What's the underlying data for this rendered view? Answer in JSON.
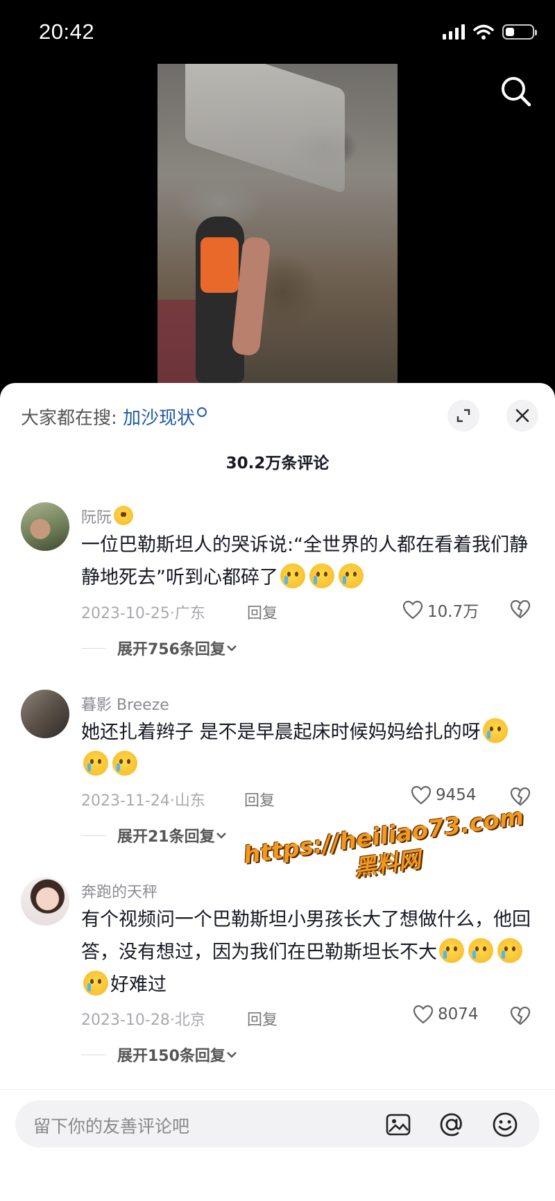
{
  "status_bar": {
    "time": "20:42"
  },
  "sheet": {
    "search_hint_label": "大家都在搜:",
    "search_hint_keyword": "加沙现状",
    "comment_count": "30.2万条评论"
  },
  "comments": [
    {
      "username": "阮阮",
      "text_before": "一位巴勒斯坦人的哭诉说:“全世界的人都在看着我们静静地死去”听到心都碎了",
      "date_location": "2023-10-25·广东",
      "reply_label": "回复",
      "likes": "10.7万",
      "expand_label": "展开756条回复"
    },
    {
      "username": "暮影 Breeze",
      "text_before": "她还扎着辫子 是不是早晨起床时候妈妈给扎的呀",
      "date_location": "2023-11-24·山东",
      "reply_label": "回复",
      "likes": "9454",
      "expand_label": "展开21条回复"
    },
    {
      "username": "奔跑的天秤",
      "text_before": "有个视频问一个巴勒斯坦小男孩长大了想做什么，他回答，没有想过，因为我们在巴勒斯坦长不大",
      "text_after": "好难过",
      "date_location": "2023-10-28·北京",
      "reply_label": "回复",
      "likes": "8074",
      "expand_label": "展开150条回复"
    }
  ],
  "watermark": {
    "url": "https://heiliao73.com",
    "name": "黑料网"
  },
  "input_bar": {
    "placeholder": "留下你的友善评论吧"
  },
  "icons": [
    "search-icon",
    "expand-icon",
    "close-icon",
    "heart-icon",
    "dislike-icon",
    "chevron-down-icon",
    "image-icon",
    "at-icon",
    "emoji-icon"
  ]
}
